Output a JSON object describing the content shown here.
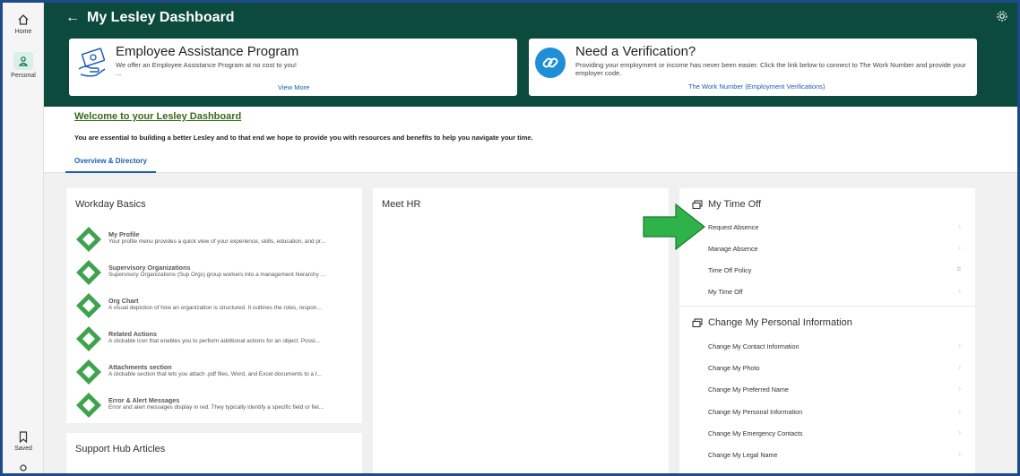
{
  "rail": {
    "home_label": "Home",
    "personal_label": "Personal",
    "saved_label": "Saved"
  },
  "header": {
    "title": "My Lesley Dashboard",
    "accent_color": "#0b4a3c"
  },
  "banners": [
    {
      "title": "Employee Assistance Program",
      "text": "We offer an Employee Assistance Program at no cost to you!",
      "ellipsis": "...",
      "link": "View More"
    },
    {
      "title": "Need a Verification?",
      "text": "Providing your employment or income has never been easier. Click the link below to connect to The Work Number and provide your employer code.",
      "link": "The Work Number (Employment Verifications)"
    }
  ],
  "welcome": {
    "title": "Welcome to your Lesley Dashboard",
    "text": "You are essential to building a better Lesley and to that end we hope to provide you with resources and benefits to help you navigate your time."
  },
  "tabs": [
    {
      "label": "Overview & Directory",
      "active": true
    }
  ],
  "workday_basics": {
    "title": "Workday Basics",
    "items": [
      {
        "name": "My Profile",
        "desc": "Your profile menu provides a quick view of your experience, skills, education, and pr..."
      },
      {
        "name": "Supervisory Organizations",
        "desc": "Supervisory Organizations (Sup Orgs) group workers into a management hierarchy ..."
      },
      {
        "name": "Org Chart",
        "desc": "A visual depiction of how an organization is structured. It outlines the roles, respon..."
      },
      {
        "name": "Related Actions",
        "desc": "A clickable icon that enables you to perform additional actions for an object. Possi..."
      },
      {
        "name": "Attachments section",
        "desc": "A clickable section that lets you attach .pdf files, Word, and Excel documents to a t..."
      },
      {
        "name": "Error & Alert Messages",
        "desc": "Error and alert messages display in red. They typically identify a specific field or fiel..."
      }
    ]
  },
  "support_hub": {
    "title": "Support Hub Articles"
  },
  "meet_hr": {
    "title": "Meet HR"
  },
  "time_off": {
    "title": "My Time Off",
    "items": [
      {
        "label": "Request Absence",
        "icon": "chevron-right-icon"
      },
      {
        "label": "Manage Absence",
        "icon": "chevron-right-icon"
      },
      {
        "label": "Time Off Policy",
        "icon": "external-link-icon"
      },
      {
        "label": "My Time Off",
        "icon": "chevron-right-icon"
      }
    ]
  },
  "personal_info": {
    "title": "Change My Personal Information",
    "items": [
      {
        "label": "Change My Contact Information"
      },
      {
        "label": "Change My Photo"
      },
      {
        "label": "Change My Preferred Name"
      },
      {
        "label": "Change My Personal Information"
      },
      {
        "label": "Change My Emergency Contacts"
      },
      {
        "label": "Change My Legal Name"
      }
    ]
  },
  "colors": {
    "header_bg": "#0b4a3c",
    "link_blue": "#1a5fb4",
    "welcome_green": "#3a6a1b",
    "arrow_green": "#2db34a"
  }
}
